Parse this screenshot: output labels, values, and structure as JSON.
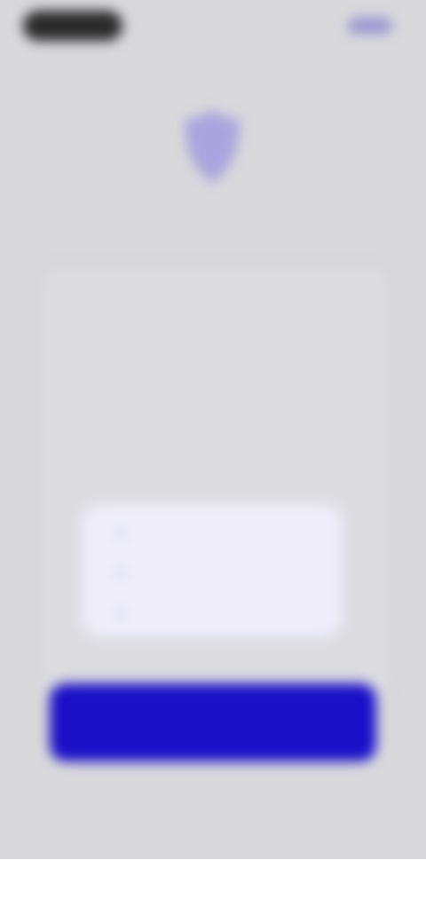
{
  "status_bar": {
    "time": "",
    "action_label": ""
  },
  "header": {
    "icon": "shield-icon",
    "intro_text": ""
  },
  "message": {
    "text": ""
  },
  "options": [
    {
      "label": "",
      "icon": "option-marker-icon"
    },
    {
      "label": "",
      "icon": "option-marker-icon"
    },
    {
      "label": "",
      "icon": "option-marker-icon"
    }
  ],
  "primary_action": {
    "label": ""
  },
  "colors": {
    "background": "#d9d9dc",
    "accent": "#1b0fc7",
    "shield": "#aba3dd",
    "panel": "#eeedf9"
  }
}
